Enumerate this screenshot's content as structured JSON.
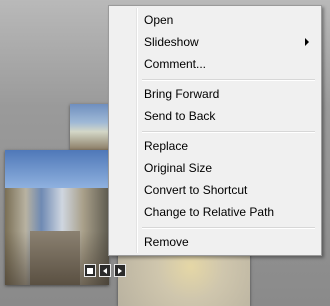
{
  "menu": {
    "items": {
      "open": "Open",
      "slideshow": "Slideshow",
      "comment": "Comment...",
      "bring_forward": "Bring Forward",
      "send_to_back": "Send to Back",
      "replace": "Replace",
      "original_size": "Original Size",
      "convert_to_shortcut": "Convert to Shortcut",
      "change_to_relative_path": "Change to Relative Path",
      "remove": "Remove"
    }
  },
  "icons": {
    "submenu": "chevron-right-icon",
    "stop": "stop-icon",
    "previous": "previous-icon",
    "next": "next-icon"
  },
  "colors": {
    "menu_bg": "#f0f0f0",
    "menu_border": "#9a9a9a",
    "desktop_bg": "#9a9a9a"
  }
}
